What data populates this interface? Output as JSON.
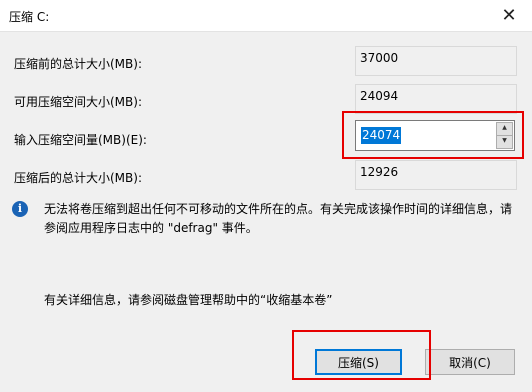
{
  "window": {
    "title": "压缩 C:"
  },
  "fields": [
    {
      "label": "压缩前的总计大小(MB):",
      "value": "37000"
    },
    {
      "label": "可用压缩空间大小(MB):",
      "value": "24094"
    },
    {
      "label": "输入压缩空间量(MB)(E):",
      "value": "24074"
    },
    {
      "label": "压缩后的总计大小(MB):",
      "value": "12926"
    }
  ],
  "info_message": "无法将卷压缩到超出任何不可移动的文件所在的点。有关完成该操作时间的详细信息，请参阅应用程序日志中的 \"defrag\" 事件。",
  "help_message": "有关详细信息，请参阅磁盘管理帮助中的“收缩基本卷”",
  "buttons": {
    "shrink": "压缩(S)",
    "cancel": "取消(C)"
  },
  "colors": {
    "highlight_box": "#e60000",
    "selection": "#0078d7"
  },
  "icons": {
    "info": "info-icon",
    "close": "close-icon"
  }
}
